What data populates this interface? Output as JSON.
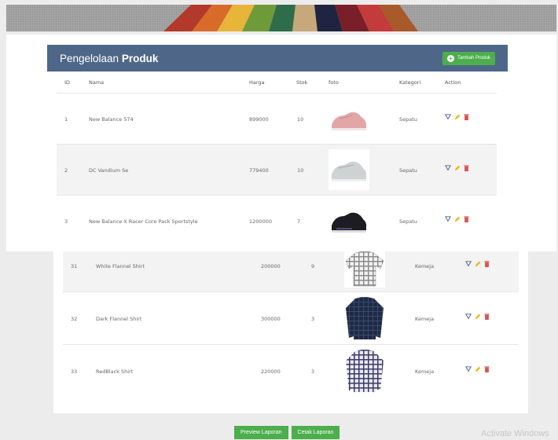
{
  "panel": {
    "title_prefix": "Pengelolaan ",
    "title_bold": "Produk",
    "add_button": "Tambah Produk"
  },
  "columns": {
    "id": "ID",
    "nama": "Nama",
    "harga": "Harga",
    "stok": "Stok",
    "foto": "foto",
    "kategori": "Kategori",
    "action": "Action"
  },
  "rows_top": [
    {
      "id": "1",
      "nama": "New Balance 574",
      "harga": "899000",
      "stok": "10",
      "kategori": "Sepatu",
      "foto": "pink-sneaker"
    },
    {
      "id": "2",
      "nama": "DC Vandium Se",
      "harga": "779400",
      "stok": "10",
      "kategori": "Sepatu",
      "foto": "grey-sneaker"
    },
    {
      "id": "3",
      "nama": "New Balance X Racer Core Pack Sportstyle",
      "harga": "1200000",
      "stok": "7",
      "kategori": "Sepatu",
      "foto": "black-sneaker"
    }
  ],
  "rows_bottom": [
    {
      "id": "31",
      "nama": "White Flannel Shirt",
      "harga": "200000",
      "stok": "9",
      "kategori": "Kemeja",
      "foto": "white-flannel-shirt"
    },
    {
      "id": "32",
      "nama": "Dark Flannel Shirt",
      "harga": "300000",
      "stok": "3",
      "kategori": "Kemeja",
      "foto": "dark-flannel-shirt"
    },
    {
      "id": "33",
      "nama": "RedBlack Shirt",
      "harga": "220000",
      "stok": "3",
      "kategori": "Kemeja",
      "foto": "redblack-shirt"
    }
  ],
  "footer": {
    "preview_button": "Preview Laporan",
    "print_button": "Cetak Laporan"
  },
  "watermark": "Activate Windows",
  "colors": {
    "header": "#4e6788",
    "green": "#4cae4c",
    "edit": "#f0b400",
    "delete": "#d9534f",
    "detail": "#4e6788"
  }
}
